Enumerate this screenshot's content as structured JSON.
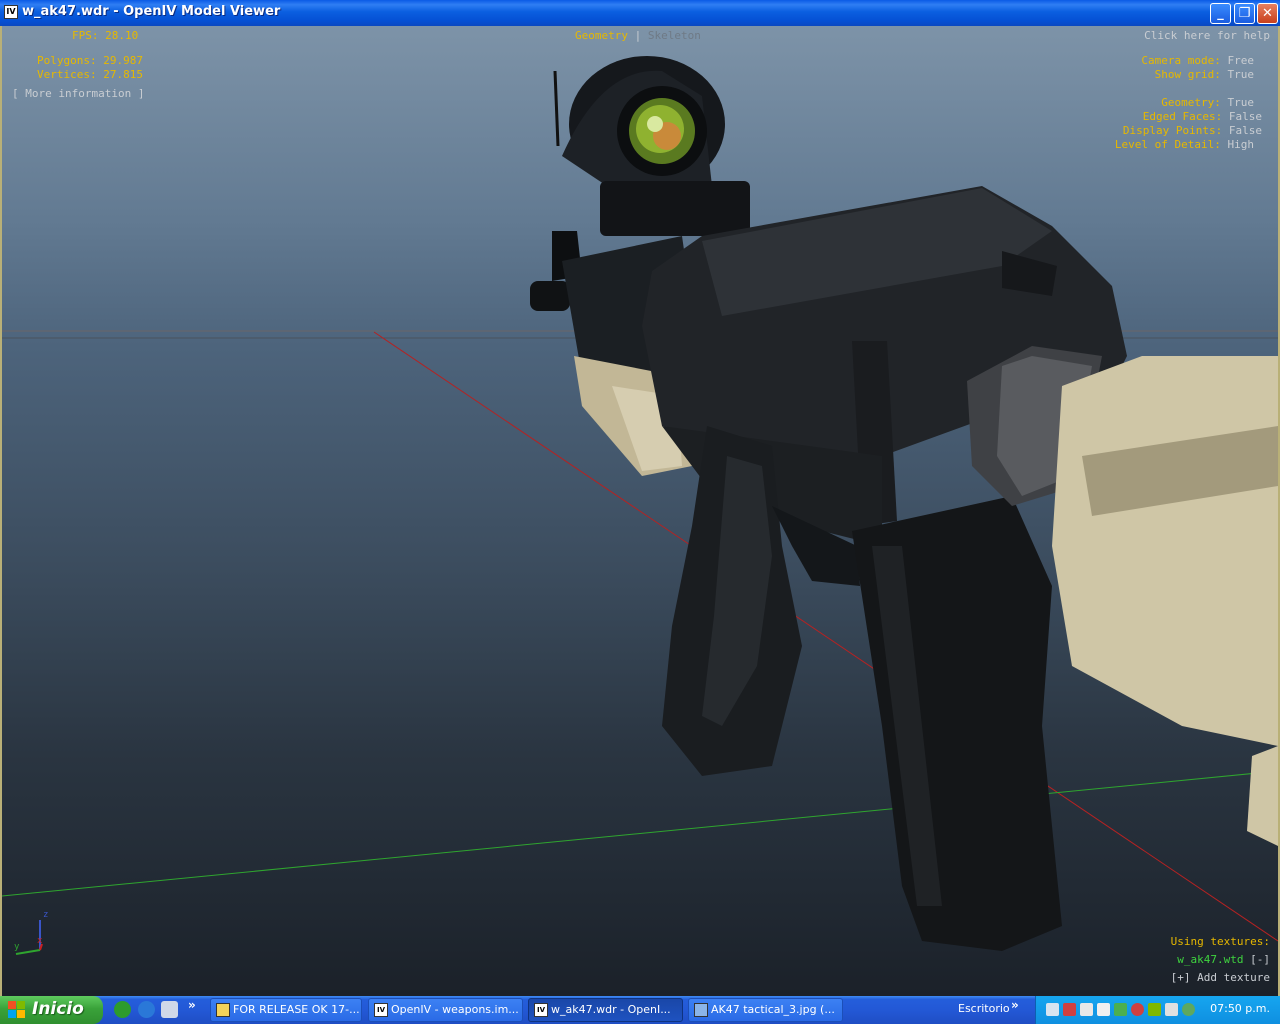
{
  "window": {
    "icon_text": "IV",
    "title": "w_ak47.wdr - OpenIV Model Viewer",
    "minimize": "_",
    "maximize": "❐",
    "close": "✕"
  },
  "hud": {
    "fps_label": "FPS:",
    "fps_value": "28.10",
    "polygons_label": "Polygons:",
    "polygons_value": "29.987",
    "vertices_label": "Vertices:",
    "vertices_value": "27.815",
    "more_info": "[ More information ]",
    "tab_geometry": "Geometry",
    "tab_separator": "|",
    "tab_skeleton": "Skeleton",
    "help": "Click here for help",
    "camera_mode_label": "Camera mode:",
    "camera_mode_value": "Free",
    "show_grid_label": "Show grid:",
    "show_grid_value": "True",
    "geometry_label": "Geometry:",
    "geometry_value": "True",
    "edged_faces_label": "Edged Faces:",
    "edged_faces_value": "False",
    "display_points_label": "Display Points:",
    "display_points_value": "False",
    "lod_label": "Level of Detail:",
    "lod_value": "High",
    "using_textures": "Using textures:",
    "texture_file": "w_ak47.wtd",
    "texture_remove": "[-]",
    "add_texture": "[+] Add texture",
    "axis_z": "z",
    "axis_y": "y",
    "axis_x": "x"
  },
  "taskbar": {
    "start_label": "Inicio",
    "chevron": "»",
    "buttons": [
      {
        "icon": "folder",
        "label": "FOR RELEASE OK 17-..."
      },
      {
        "icon": "IV",
        "label": "OpenIV - weapons.im..."
      },
      {
        "icon": "IV",
        "label": "w_ak47.wdr - OpenI..."
      },
      {
        "icon": "image",
        "label": "AK47 tactical_3.jpg (..."
      }
    ],
    "desktop_label": "Escritorio",
    "clock": "07:50 p.m."
  },
  "colors": {
    "hud_label": "#e6b800",
    "hud_value": "#c9cdd2",
    "texture_file": "#3fd43f",
    "xp_blue": "#245edb",
    "start_green": "#3aa23a"
  }
}
